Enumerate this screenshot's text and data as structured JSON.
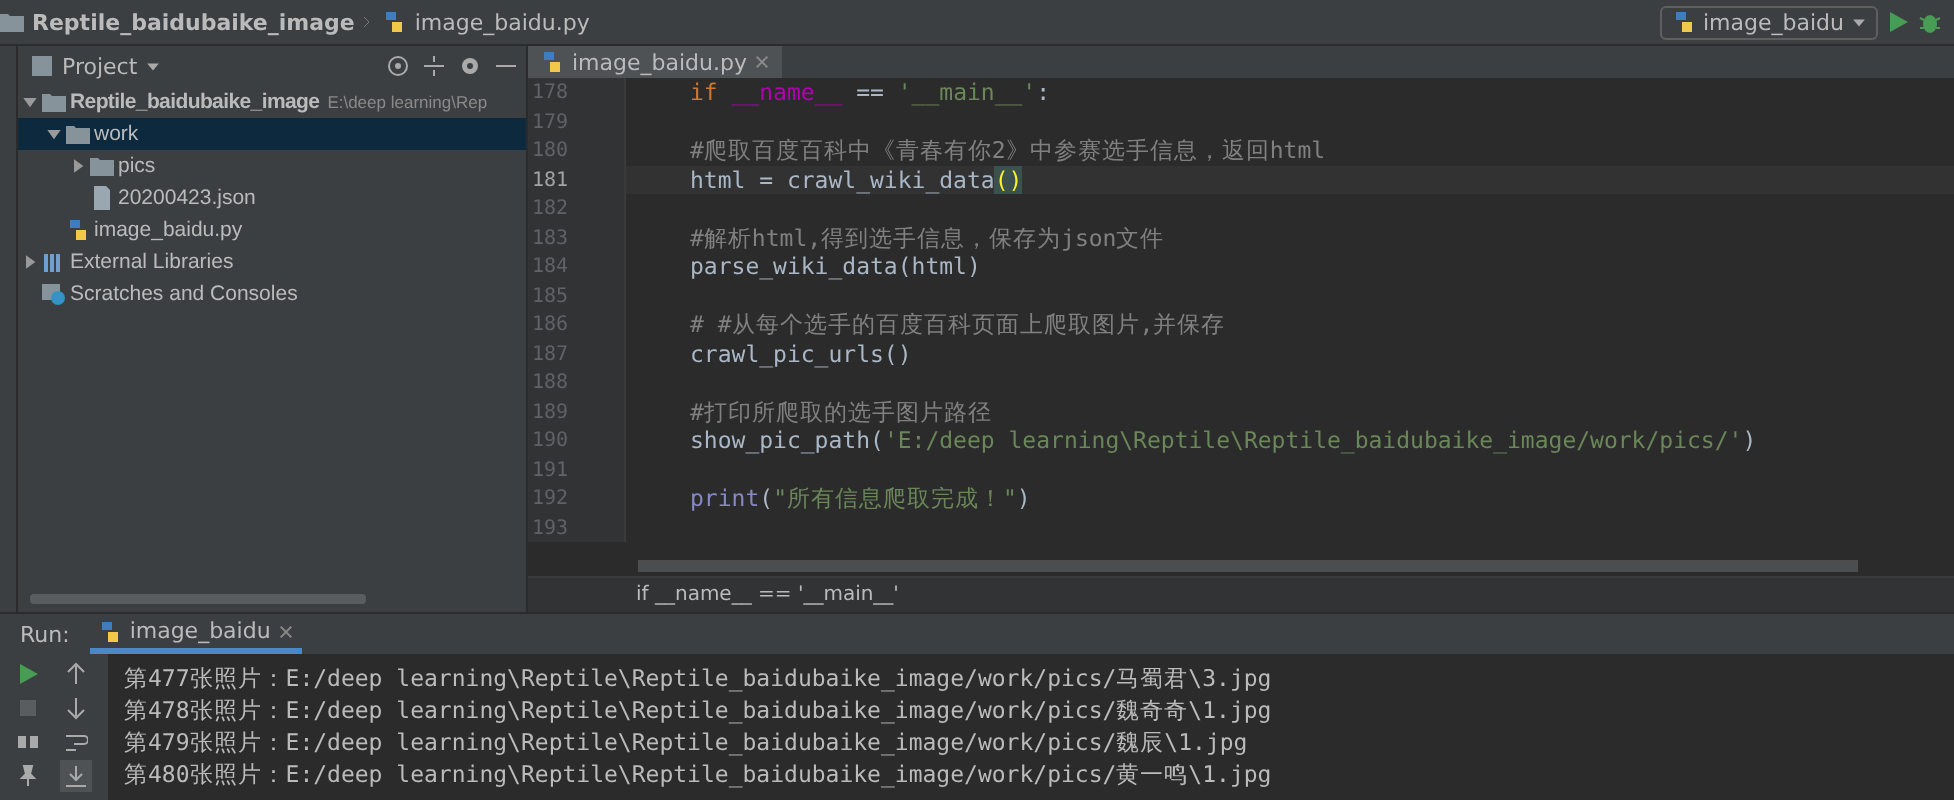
{
  "navbar": {
    "project": "Reptile_baidubaike_image",
    "file": "image_baidu.py",
    "run_config": "image_baidu"
  },
  "project_panel": {
    "title": "Project",
    "tree": [
      {
        "label": "Reptile_baidubaike_image",
        "path": "E:\\deep learning\\Rep",
        "kind": "folder",
        "expanded": true,
        "selected": false,
        "children": [
          {
            "label": "work",
            "kind": "folder",
            "expanded": true,
            "selected": true,
            "children": [
              {
                "label": "pics",
                "kind": "folder",
                "expanded": false,
                "selected": false
              },
              {
                "label": "20200423.json",
                "kind": "json",
                "selected": false
              }
            ]
          },
          {
            "label": "image_baidu.py",
            "kind": "python",
            "selected": false
          }
        ]
      },
      {
        "label": "External Libraries",
        "kind": "library",
        "expanded": false,
        "selected": false
      },
      {
        "label": "Scratches and Consoles",
        "kind": "scratches",
        "selected": false
      }
    ]
  },
  "editor": {
    "tabs": [
      {
        "label": "image_baidu.py",
        "selected": true
      }
    ],
    "lines": [
      {
        "number": "178",
        "current": false,
        "tokens": [
          {
            "text": "if ",
            "kind": "keyword"
          },
          {
            "text": "__name__",
            "kind": "dunder"
          },
          {
            "text": " == ",
            "kind": "plain"
          },
          {
            "text": "'__main__'",
            "kind": "string"
          },
          {
            "text": ":",
            "kind": "plain"
          }
        ]
      },
      {
        "number": "179",
        "current": false
      },
      {
        "number": "180",
        "current": false,
        "tokens": [
          {
            "text": "#爬取百度百科中《青春有你2》中参赛选手信息，返回html",
            "kind": "comment"
          }
        ]
      },
      {
        "number": "181",
        "current": true,
        "tokens": [
          {
            "text": "html = crawl_wiki_data",
            "kind": "plain"
          },
          {
            "text": "()",
            "kind": "bracket"
          }
        ]
      },
      {
        "number": "182",
        "current": false
      },
      {
        "number": "183",
        "current": false,
        "tokens": [
          {
            "text": "#解析html,得到选手信息，保存为json文件",
            "kind": "comment"
          }
        ]
      },
      {
        "number": "184",
        "current": false,
        "tokens": [
          {
            "text": "parse_wiki_data(html)",
            "kind": "plain"
          }
        ]
      },
      {
        "number": "185",
        "current": false
      },
      {
        "number": "186",
        "current": false,
        "tokens": [
          {
            "text": "# #从每个选手的百度百科页面上爬取图片,并保存",
            "kind": "comment"
          }
        ]
      },
      {
        "number": "187",
        "current": false,
        "tokens": [
          {
            "text": "crawl_pic_urls()",
            "kind": "plain"
          }
        ]
      },
      {
        "number": "188",
        "current": false
      },
      {
        "number": "189",
        "current": false,
        "tokens": [
          {
            "text": "#打印所爬取的选手图片路径",
            "kind": "comment"
          }
        ]
      },
      {
        "number": "190",
        "current": false,
        "tokens": [
          {
            "text": "show_pic_path(",
            "kind": "plain"
          },
          {
            "text": "'E:/deep learning\\Reptile\\Reptile_baidubaike_image/work/pics/'",
            "kind": "string"
          },
          {
            "text": ")",
            "kind": "plain"
          }
        ]
      },
      {
        "number": "191",
        "current": false
      },
      {
        "number": "192",
        "current": false,
        "tokens": [
          {
            "text": "print",
            "kind": "builtin"
          },
          {
            "text": "(",
            "kind": "plain"
          },
          {
            "text": "\"所有信息爬取完成！\"",
            "kind": "string"
          },
          {
            "text": ")",
            "kind": "plain"
          }
        ]
      },
      {
        "number": "193",
        "current": false
      }
    ],
    "breadcrumb": "if __name__ == '__main__'"
  },
  "run_panel": {
    "label": "Run:",
    "tab": "image_baidu",
    "output": [
      "第477张照片：E:/deep learning\\Reptile\\Reptile_baidubaike_image/work/pics/马蜀君\\3.jpg",
      "第478张照片：E:/deep learning\\Reptile\\Reptile_baidubaike_image/work/pics/魏奇奇\\1.jpg",
      "第479张照片：E:/deep learning\\Reptile\\Reptile_baidubaike_image/work/pics/魏辰\\1.jpg",
      "第480张照片：E:/deep learning\\Reptile\\Reptile_baidubaike_image/work/pics/黄一鸣\\1.jpg"
    ]
  }
}
